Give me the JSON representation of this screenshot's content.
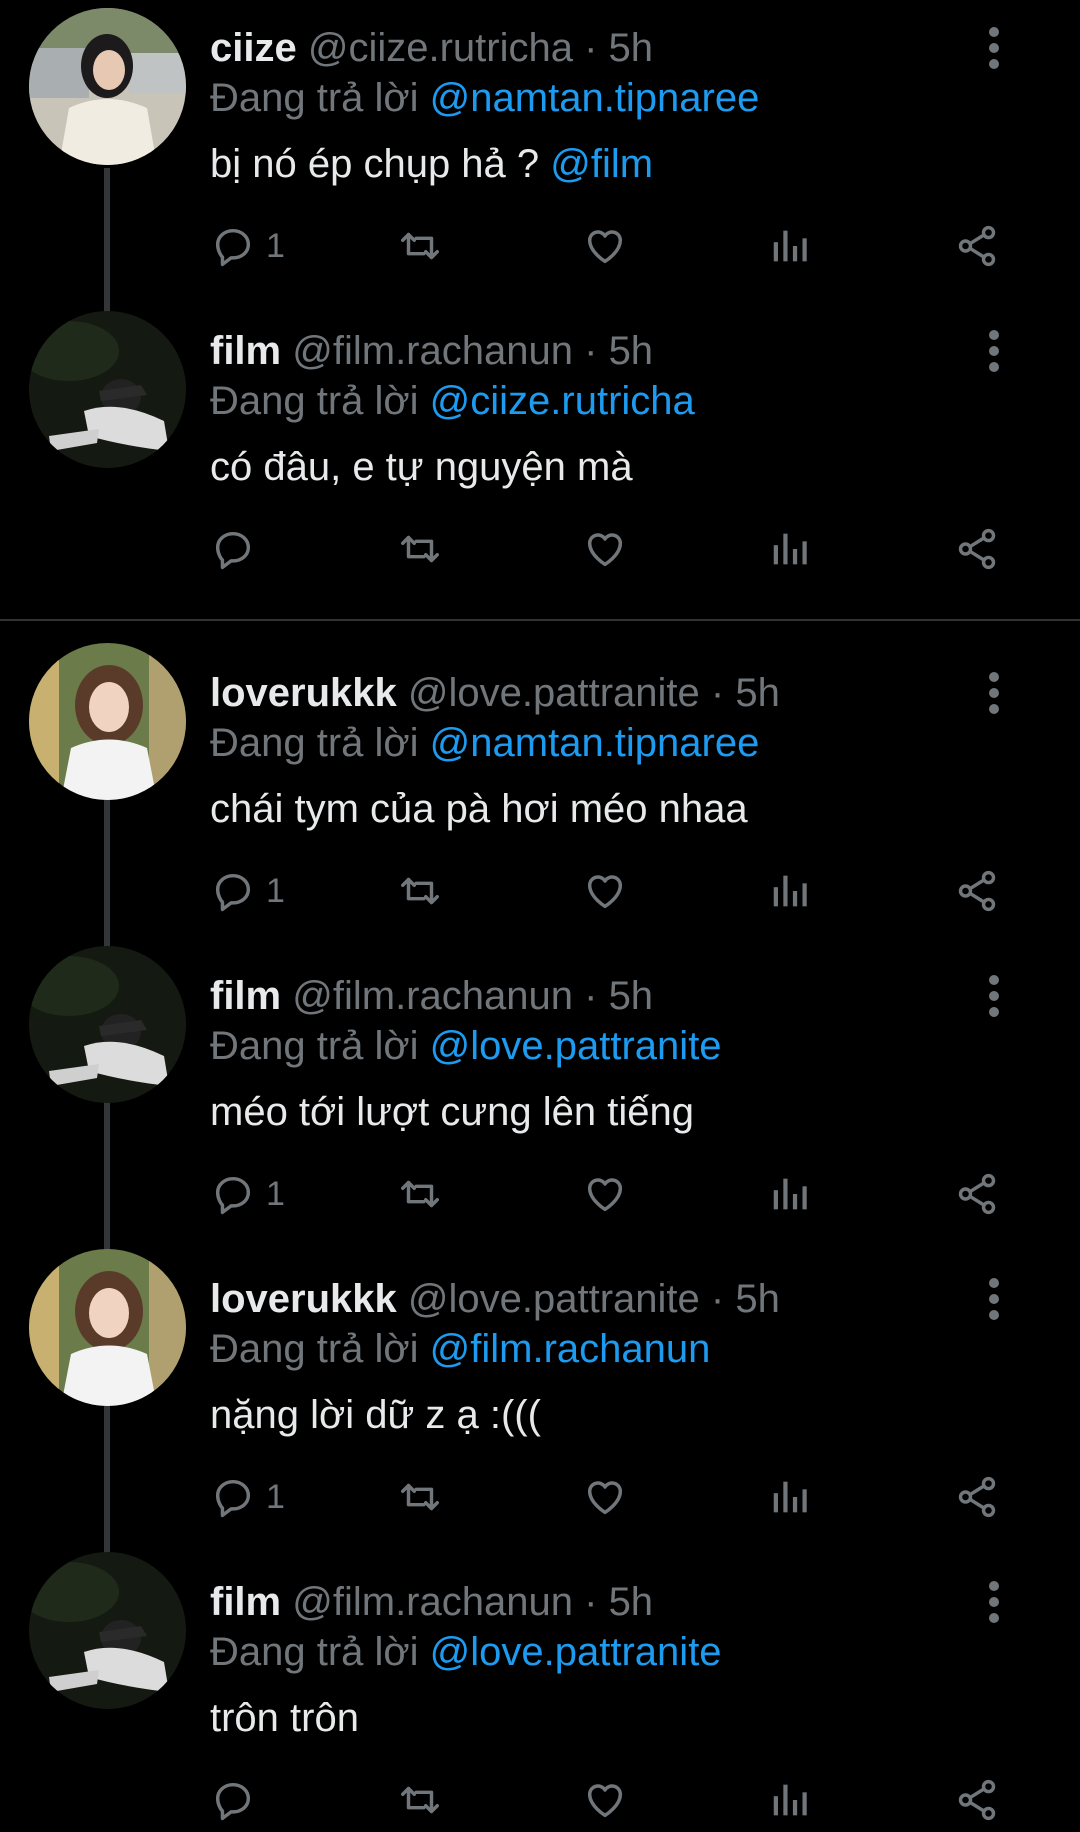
{
  "colors": {
    "background": "#000000",
    "text": "#e7e9ea",
    "secondary": "#71767b",
    "accent": "#1d9bf0",
    "thread_line": "#333639"
  },
  "tweets": [
    {
      "name": "ciize",
      "handle": "@ciize.rutricha",
      "dot": "·",
      "time": "5h",
      "reply_prefix": "Đang trả lời",
      "reply_to": "@namtan.tipnaree",
      "text": "bị nó ép chụp hả ? ",
      "text_mention": "@film",
      "reply_count": "1",
      "avatar": "avatar-ciize"
    },
    {
      "name": "film",
      "handle": "@film.rachanun",
      "dot": "·",
      "time": "5h",
      "reply_prefix": "Đang trả lời",
      "reply_to": "@ciize.rutricha",
      "text": "có đâu, e tự nguyện mà",
      "text_mention": "",
      "reply_count": "",
      "avatar": "avatar-film"
    },
    {
      "name": "loverukkk",
      "handle": "@love.pattranite",
      "dot": "·",
      "time": "5h",
      "reply_prefix": "Đang trả lời",
      "reply_to": "@namtan.tipnaree",
      "text": "chái tym của pà hơi méo nhaa",
      "text_mention": "",
      "reply_count": "1",
      "avatar": "avatar-loverukkk"
    },
    {
      "name": "film",
      "handle": "@film.rachanun",
      "dot": "·",
      "time": "5h",
      "reply_prefix": "Đang trả lời",
      "reply_to": "@love.pattranite",
      "text": "méo tới lượt cưng lên tiếng",
      "text_mention": "",
      "reply_count": "1",
      "avatar": "avatar-film"
    },
    {
      "name": "loverukkk",
      "handle": "@love.pattranite",
      "dot": "·",
      "time": "5h",
      "reply_prefix": "Đang trả lời",
      "reply_to": "@film.rachanun",
      "text": "nặng lời dữ z ạ :(((",
      "text_mention": "",
      "reply_count": "1",
      "avatar": "avatar-loverukkk"
    },
    {
      "name": "film",
      "handle": "@film.rachanun",
      "dot": "·",
      "time": "5h",
      "reply_prefix": "Đang trả lời",
      "reply_to": "@love.pattranite",
      "text": "trôn trôn",
      "text_mention": "",
      "reply_count": "",
      "avatar": "avatar-film"
    }
  ],
  "icons": {
    "reply": "reply-icon",
    "retweet": "retweet-icon",
    "like": "like-icon",
    "views": "views-icon",
    "share": "share-icon",
    "more": "more-vertical-icon"
  }
}
